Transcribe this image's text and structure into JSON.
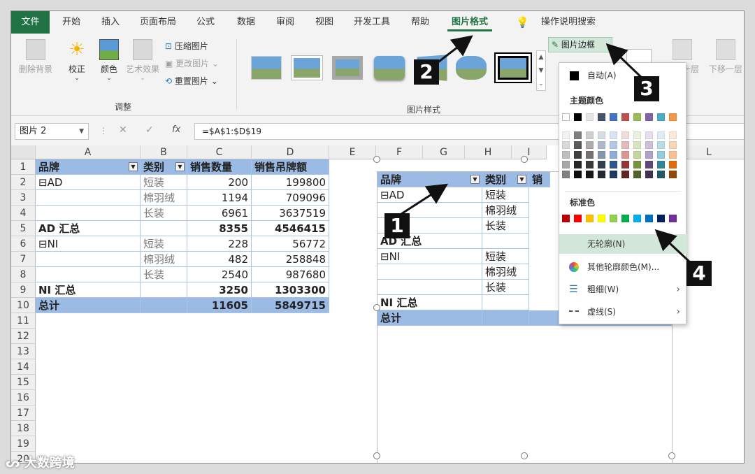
{
  "tabs": [
    "文件",
    "开始",
    "插入",
    "页面布局",
    "公式",
    "数据",
    "审阅",
    "视图",
    "开发工具",
    "帮助",
    "图片格式"
  ],
  "tell_me": "操作说明搜索",
  "ribbon": {
    "remove_bg": "删除背景",
    "corrections": "校正",
    "color": "颜色",
    "artistic": "艺术效果",
    "compress": "压缩图片",
    "change": "更改图片",
    "reset": "重置图片",
    "adjust_group": "调整",
    "styles_group": "图片样式",
    "border_btn": "图片边框",
    "forward": "上移一层",
    "backward": "下移一层"
  },
  "formula": {
    "namebox": "图片 2",
    "formula": "=$A$1:$D$19",
    "fx": "fx"
  },
  "columns": [
    "A",
    "B",
    "C",
    "D",
    "E",
    "F",
    "G",
    "H",
    "I",
    "L"
  ],
  "rows": [
    "1",
    "2",
    "3",
    "4",
    "5",
    "6",
    "7",
    "8",
    "9",
    "10",
    "11",
    "12",
    "13",
    "14",
    "15",
    "16",
    "17",
    "18",
    "19",
    "20"
  ],
  "table": {
    "headers": [
      "品牌",
      "类别",
      "销售数量",
      "销售吊牌额"
    ],
    "r2": [
      "⊟AD",
      "短装",
      "200",
      "199800"
    ],
    "r3": [
      "",
      "棉羽绒",
      "1194",
      "709096"
    ],
    "r4": [
      "",
      "长装",
      "6961",
      "3637519"
    ],
    "r5": [
      "AD 汇总",
      "",
      "8355",
      "4546415"
    ],
    "r6": [
      "⊟NI",
      "短装",
      "228",
      "56772"
    ],
    "r7": [
      "",
      "棉羽绒",
      "482",
      "258848"
    ],
    "r8": [
      "",
      "长装",
      "2540",
      "987680"
    ],
    "r9": [
      "NI 汇总",
      "",
      "3250",
      "1303300"
    ],
    "r10": [
      "总计",
      "",
      "11605",
      "5849715"
    ]
  },
  "picture": {
    "headers": [
      "品牌",
      "类别",
      "销"
    ],
    "rows": [
      [
        "⊟AD",
        "短装"
      ],
      [
        "",
        "棉羽绒"
      ],
      [
        "",
        "长装"
      ],
      [
        "AD 汇总",
        ""
      ],
      [
        "⊟NI",
        "短装"
      ],
      [
        "",
        "棉羽绒"
      ],
      [
        "",
        "长装"
      ],
      [
        "NI 汇总",
        ""
      ],
      [
        "总计",
        ""
      ]
    ]
  },
  "dropdown": {
    "auto": "自动(A)",
    "theme_colors": "主题颜色",
    "standard_colors": "标准色",
    "no_outline": "无轮廓(N)",
    "more_colors": "其他轮廓颜色(M)...",
    "weight": "粗细(W)",
    "dashes": "虚线(S)",
    "theme_top": [
      "#ffffff",
      "#000000",
      "#e7e6e6",
      "#44546a",
      "#4472c4",
      "#c0504d",
      "#9bbb59",
      "#8064a2",
      "#4bacc6",
      "#f79646"
    ],
    "theme_cols": [
      [
        "#f2f2f2",
        "#d9d9d9",
        "#bfbfbf",
        "#a6a6a6",
        "#808080"
      ],
      [
        "#7f7f7f",
        "#595959",
        "#404040",
        "#262626",
        "#0d0d0d"
      ],
      [
        "#d0cece",
        "#aeabab",
        "#757171",
        "#3a3838",
        "#171616"
      ],
      [
        "#d6dce4",
        "#adb9ca",
        "#8496b0",
        "#333f4f",
        "#222a35"
      ],
      [
        "#dae3f3",
        "#b4c7e7",
        "#8faadc",
        "#2f5597",
        "#1f3864"
      ],
      [
        "#f2dcdb",
        "#e6b8b7",
        "#da9694",
        "#953734",
        "#632523"
      ],
      [
        "#ebf1de",
        "#d7e4bc",
        "#c3d69b",
        "#76923c",
        "#4f6228"
      ],
      [
        "#e5e0ec",
        "#ccc1da",
        "#b2a2c7",
        "#5f497a",
        "#3f3151"
      ],
      [
        "#dbeef3",
        "#b7dde8",
        "#92cddc",
        "#31859b",
        "#215967"
      ],
      [
        "#fde9d9",
        "#fbd4b4",
        "#fac08f",
        "#e36c09",
        "#974806"
      ]
    ],
    "standard": [
      "#c00000",
      "#ff0000",
      "#ffc000",
      "#ffff00",
      "#92d050",
      "#00b050",
      "#00b0f0",
      "#0070c0",
      "#002060",
      "#7030a0"
    ]
  },
  "callouts": [
    "1",
    "2",
    "3",
    "4"
  ],
  "watermark": "大数跨境"
}
